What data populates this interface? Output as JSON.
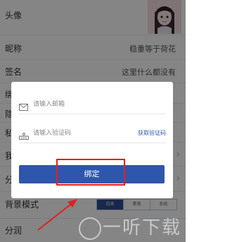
{
  "settings": {
    "avatar_label": "头像",
    "nickname_label": "昵称",
    "nickname_value": "稳重等于荷花",
    "signature_label": "签名",
    "signature_value": "这里什么都没有",
    "row4_label": "绑",
    "row5_label": "隐",
    "row6_label": "私",
    "row7_label": "我",
    "row8_label": "分",
    "background_mode_label": "背景模式",
    "background_modes": [
      "白天",
      "素夜",
      "系统"
    ],
    "last_row_label": "分润"
  },
  "modal": {
    "email_placeholder": "请输入邮箱",
    "code_placeholder": "请输入验证码",
    "get_code_label": "获取验证码",
    "bind_label": "绑定"
  },
  "watermark_text": "一听下载",
  "colors": {
    "primary": "#2f56ad",
    "active_mode": "#2d4e8f",
    "highlight": "#e02020"
  }
}
